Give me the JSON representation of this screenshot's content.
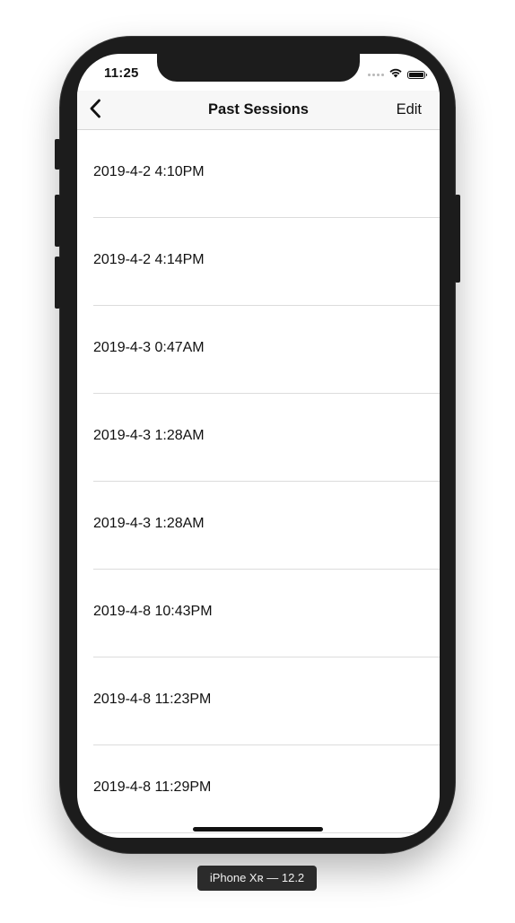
{
  "status_bar": {
    "time": "11:25",
    "wifi_icon": "wifi-icon",
    "battery_icon": "battery-icon"
  },
  "navbar": {
    "back_icon": "chevron-left-icon",
    "title": "Past Sessions",
    "edit_label": "Edit"
  },
  "sessions": [
    {
      "label": "2019-4-2 4:10PM"
    },
    {
      "label": "2019-4-2 4:14PM"
    },
    {
      "label": "2019-4-3 0:47AM"
    },
    {
      "label": "2019-4-3 1:28AM"
    },
    {
      "label": "2019-4-3 1:28AM"
    },
    {
      "label": "2019-4-8 10:43PM"
    },
    {
      "label": "2019-4-8 11:23PM"
    },
    {
      "label": "2019-4-8 11:29PM"
    }
  ],
  "device": {
    "label": "iPhone Xʀ — 12.2"
  },
  "colors": {
    "navbar_bg": "#f7f7f7",
    "separator": "#dcdcdc",
    "text": "#111111",
    "bezel": "#1c1c1c"
  }
}
